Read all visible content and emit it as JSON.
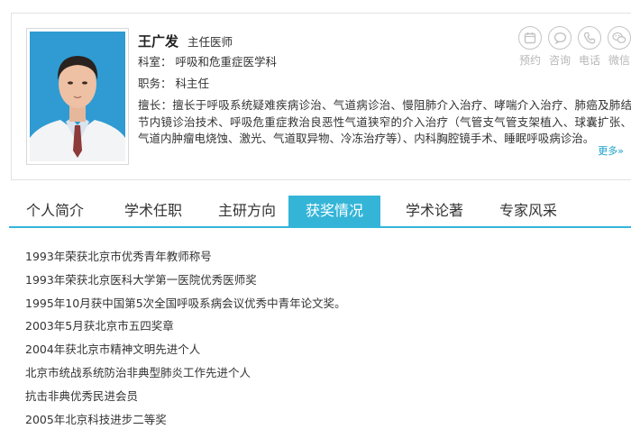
{
  "doctor": {
    "name": "王广发",
    "title": "主任医师",
    "department_label": "科室：",
    "department": "呼吸和危重症医学科",
    "position_label": "职务：",
    "position": "科主任",
    "specialty_label": "擅长：",
    "specialty": "擅长于呼吸系统疑难疾病诊治、气道病诊治、慢阻肺介入治疗、哮喘介入治疗、肺癌及肺结节内镜诊治技术、呼吸危重症救治良恶性气道狭窄的介入治疗（气管支气管支架植入、球囊扩张、气道内肿瘤电烧蚀、激光、气道取异物、冷冻治疗等）、内科胸腔镜手术、睡眠呼吸病诊治。",
    "more_label": "更多»"
  },
  "actions": [
    {
      "label": "预约",
      "icon": "calendar-icon"
    },
    {
      "label": "咨询",
      "icon": "chat-bubble-icon"
    },
    {
      "label": "电话",
      "icon": "phone-icon"
    },
    {
      "label": "微信",
      "icon": "wechat-icon"
    }
  ],
  "tabs": [
    {
      "label": "个人简介",
      "active": false
    },
    {
      "label": "学术任职",
      "active": false
    },
    {
      "label": "主研方向",
      "active": false
    },
    {
      "label": "获奖情况",
      "active": true
    },
    {
      "label": "学术论著",
      "active": false
    },
    {
      "label": "专家风采",
      "active": false
    }
  ],
  "awards": [
    "1993年荣获北京市优秀青年教师称号",
    "1993年荣获北京医科大学第一医院优秀医师奖",
    "1995年10月获中国第5次全国呼吸系病会议优秀中青年论文奖。",
    "2003年5月获北京市五四奖章",
    "2004年获北京市精神文明先进个人",
    "北京市统战系统防治非典型肺炎工作先进个人",
    "抗击非典优秀民进会员",
    "2005年北京科技进步二等奖"
  ],
  "colors": {
    "accent": "#34b5d8",
    "icon_gray": "#c4c4c4",
    "more_link": "#1aa0c6"
  }
}
